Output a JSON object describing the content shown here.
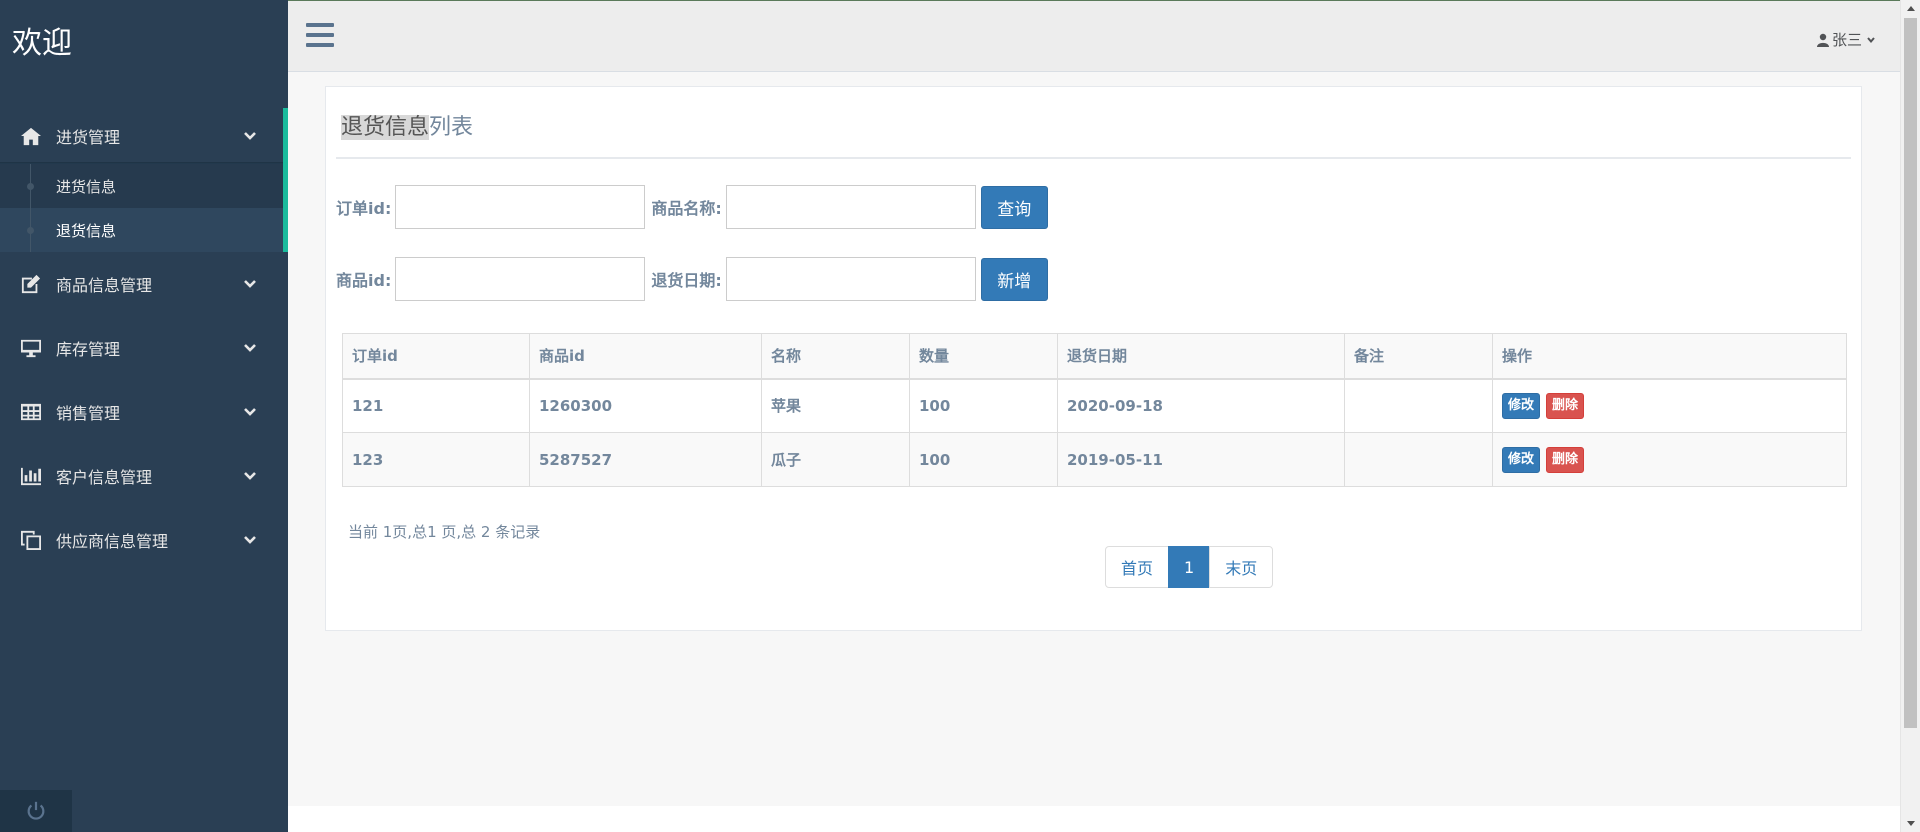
{
  "brand": "欢迎",
  "sidebar": {
    "groups": [
      {
        "label": "进货管理",
        "icon": "home-icon",
        "expanded": true,
        "children": [
          {
            "label": "进货信息"
          },
          {
            "label": "退货信息",
            "current": true
          }
        ]
      },
      {
        "label": "商品信息管理",
        "icon": "edit-icon"
      },
      {
        "label": "库存管理",
        "icon": "desktop-icon"
      },
      {
        "label": "销售管理",
        "icon": "table-icon"
      },
      {
        "label": "客户信息管理",
        "icon": "bar-chart-icon"
      },
      {
        "label": "供应商信息管理",
        "icon": "clone-icon"
      }
    ],
    "footer_icon": "power-icon"
  },
  "topbar": {
    "user_name": "张三",
    "user_icon": "user-icon",
    "menu_icon": "hamburger-icon"
  },
  "panel": {
    "title_highlight": "退货信息",
    "title_rest": "列表"
  },
  "form": {
    "order_id_label": "订单id:",
    "order_id_value": "",
    "product_name_label": "商品名称:",
    "product_name_value": "",
    "query_button": "查询",
    "product_id_label": "商品id:",
    "product_id_value": "",
    "return_date_label": "退货日期:",
    "return_date_value": "",
    "add_button": "新增"
  },
  "table": {
    "headers": [
      "订单id",
      "商品id",
      "名称",
      "数量",
      "退货日期",
      "备注",
      "操作"
    ],
    "rows": [
      {
        "order_id": "121",
        "product_id": "1260300",
        "name": "苹果",
        "qty": "100",
        "date": "2020-09-18",
        "note": ""
      },
      {
        "order_id": "123",
        "product_id": "5287527",
        "name": "瓜子",
        "qty": "100",
        "date": "2019-05-11",
        "note": ""
      }
    ],
    "edit_label": "修改",
    "delete_label": "删除"
  },
  "pagination": {
    "info": "当前 1页,总1 页,总 2 条记录",
    "first": "首页",
    "current": "1",
    "last": "末页"
  }
}
